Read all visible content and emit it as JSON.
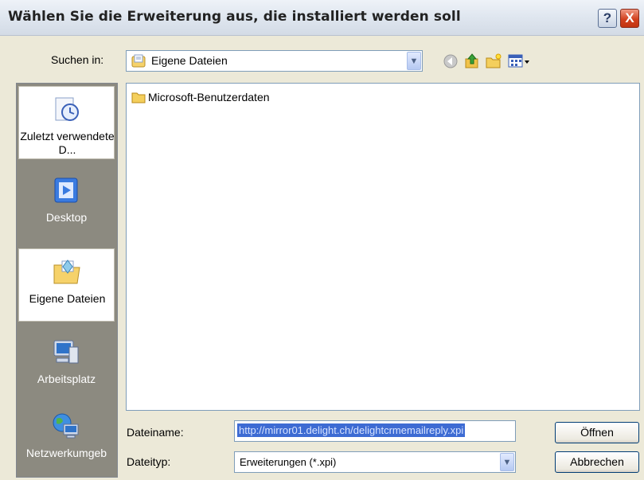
{
  "window": {
    "title": "Wählen Sie die Erweiterung aus, die installiert werden soll",
    "help_label": "?",
    "close_label": "X"
  },
  "lookin": {
    "label": "Suchen in:",
    "value": "Eigene Dateien"
  },
  "toolbar": {
    "icons": [
      "back-icon",
      "up-folder-icon",
      "new-folder-icon",
      "view-menu-icon"
    ]
  },
  "places": [
    {
      "icon": "recent-documents-icon",
      "label": "Zuletzt verwendete D..."
    },
    {
      "icon": "desktop-icon",
      "label": "Desktop"
    },
    {
      "icon": "my-documents-icon",
      "label": "Eigene Dateien"
    },
    {
      "icon": "my-computer-icon",
      "label": "Arbeitsplatz"
    },
    {
      "icon": "network-icon",
      "label": "Netzwerkumgeb"
    }
  ],
  "files": [
    {
      "name": "Microsoft-Benutzerdaten",
      "icon": "folder-icon"
    }
  ],
  "filename": {
    "label": "Dateiname:",
    "value": "http://mirror01.delight.ch/delightcrmemailreply.xpi"
  },
  "filetype": {
    "label": "Dateityp:",
    "value": "Erweiterungen (*.xpi)"
  },
  "buttons": {
    "open": "Öffnen",
    "cancel": "Abbrechen"
  },
  "colors": {
    "selection": "#3d6bd3",
    "places_bg": "#8c8a80",
    "close": "#d2411f"
  }
}
